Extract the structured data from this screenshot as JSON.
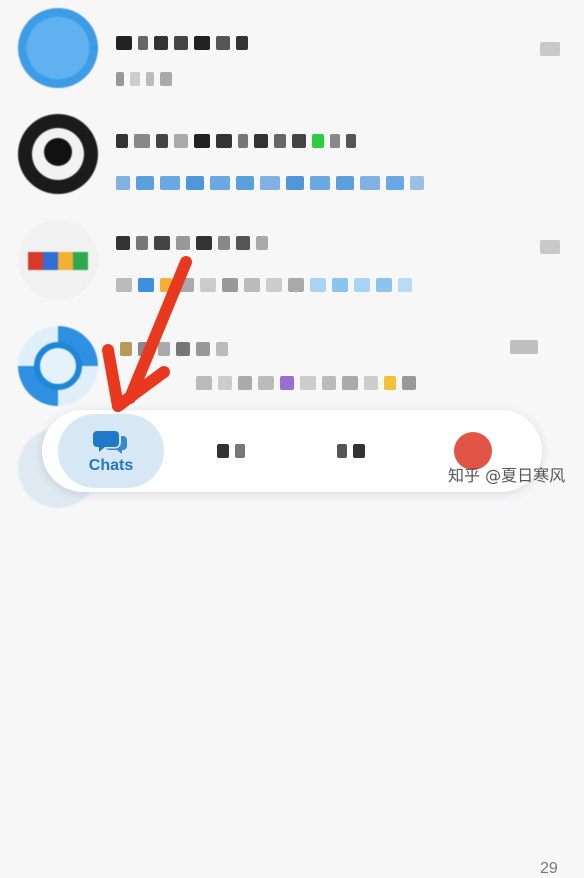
{
  "tabs": {
    "chats_label": "Chats"
  },
  "chat_rows": [
    {
      "avatar": "blurred-avatar-blue"
    },
    {
      "avatar": "blurred-avatar-dark"
    },
    {
      "avatar": "blurred-avatar-colorful"
    },
    {
      "avatar": "blurred-avatar-blue-pattern"
    },
    {
      "avatar": "blurred-avatar-partial"
    }
  ],
  "partial_row": {
    "time": "29"
  },
  "watermark": "知乎 @夏日寒风",
  "colors": {
    "accent": "#1f78c8",
    "tab_active_bg": "#d7e7f4",
    "arrow": "#e8391f"
  },
  "icons": {
    "chats": "chat-bubbles-icon",
    "arrow": "red-pointer-arrow"
  }
}
